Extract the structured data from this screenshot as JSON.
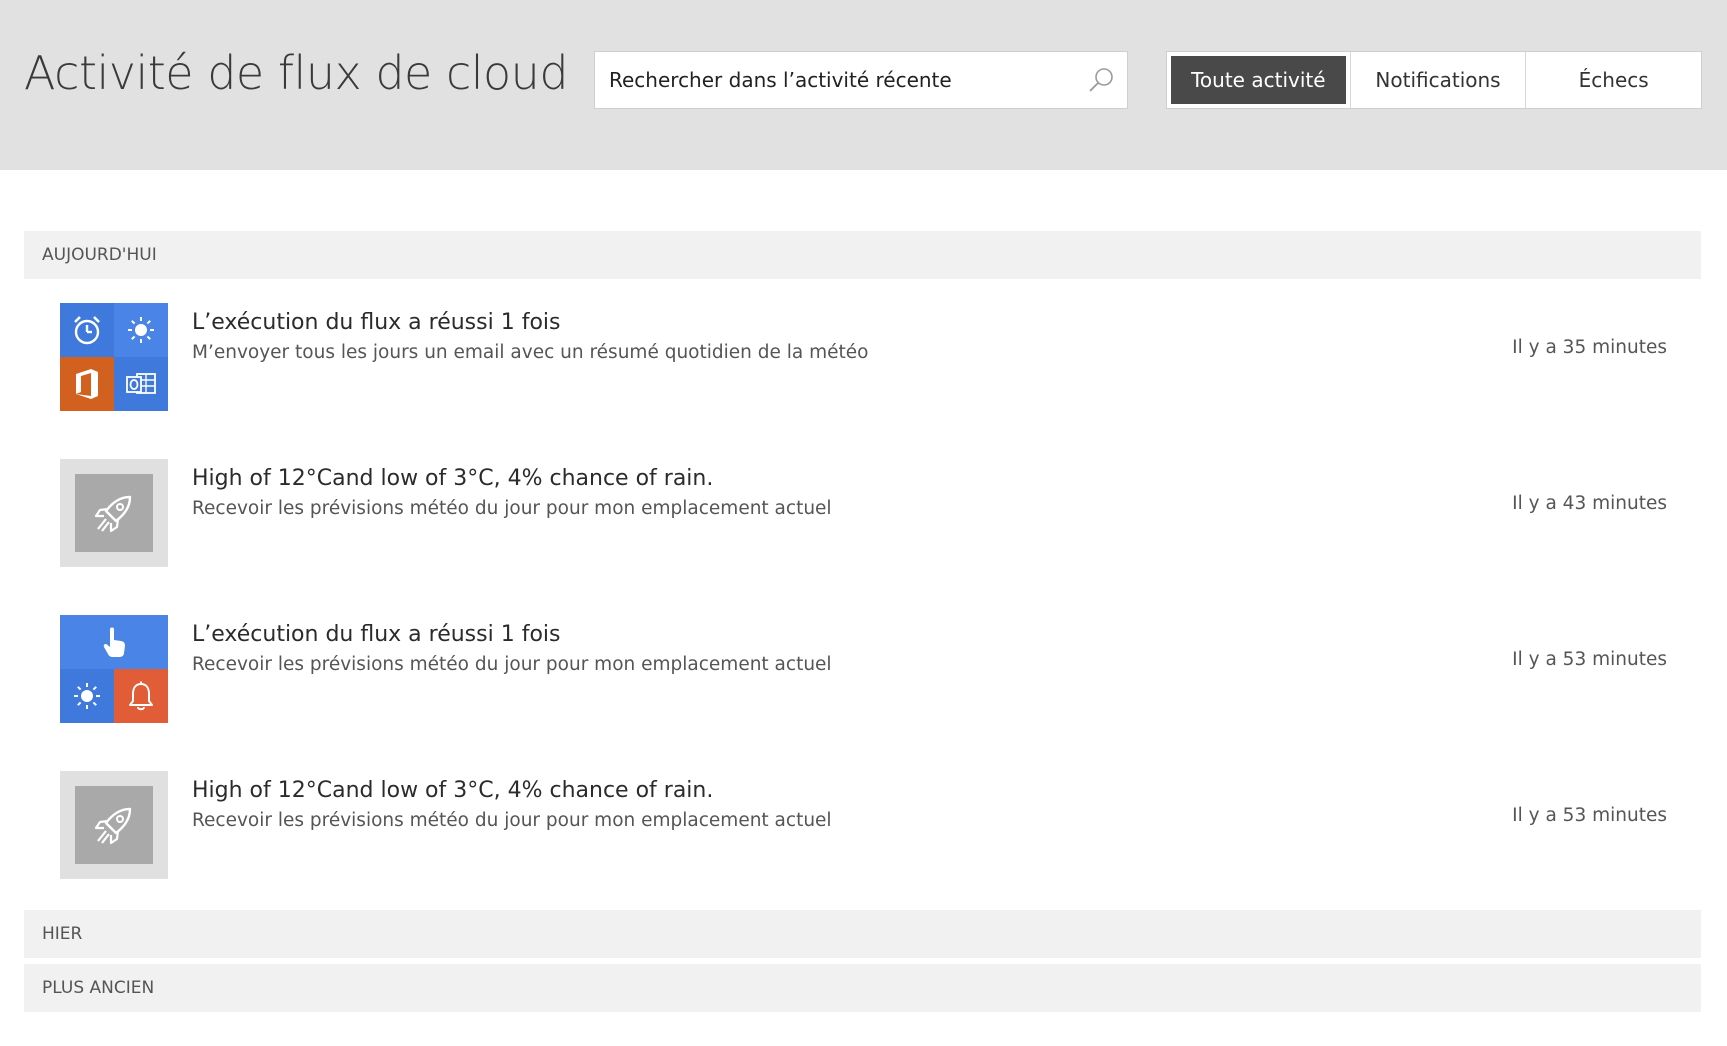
{
  "header": {
    "title": "Activité de flux de cloud",
    "search_placeholder": "Rechercher dans l’activité récente",
    "filters": [
      {
        "label": "Toute activité",
        "active": true
      },
      {
        "label": "Notifications",
        "active": false
      },
      {
        "label": "Échecs",
        "active": false
      }
    ]
  },
  "sections": {
    "today": "AUJOURD'HUI",
    "yesterday": "HIER",
    "older": "PLUS ANCIEN"
  },
  "items": [
    {
      "title": "L’exécution du flux a réussi 1 fois",
      "subtitle": "M’envoyer tous les jours un email avec un résumé quotidien de la météo",
      "time": "Il y a 35 minutes",
      "icons": [
        "alarm-clock-icon",
        "sun-icon",
        "office-icon",
        "outlook-icon"
      ]
    },
    {
      "title": "High of 12°Cand low of 3°C, 4% chance of rain.",
      "subtitle": "Recevoir les prévisions météo du jour pour mon emplacement actuel",
      "time": "Il y a 43 minutes",
      "icons": [
        "rocket-icon"
      ]
    },
    {
      "title": "L’exécution du flux a réussi 1 fois",
      "subtitle": "Recevoir les prévisions météo du jour pour mon emplacement actuel",
      "time": "Il y a 53 minutes",
      "icons": [
        "touch-icon",
        "sun-icon",
        "bell-icon"
      ]
    },
    {
      "title": "High of 12°Cand low of 3°C, 4% chance of rain.",
      "subtitle": "Recevoir les prévisions météo du jour pour mon emplacement actuel",
      "time": "Il y a 53 minutes",
      "icons": [
        "rocket-icon"
      ]
    }
  ],
  "colors": {
    "header_bg": "#e1e1e1",
    "active_filter_bg": "#494949",
    "tile_blue": "#3f79dc",
    "tile_blue_light": "#4a84e6",
    "tile_orange": "#d2601f",
    "tile_orange_bell": "#e05d37",
    "rocket_tile_bg": "#a9a9a9",
    "section_bg": "#f1f1f1"
  }
}
